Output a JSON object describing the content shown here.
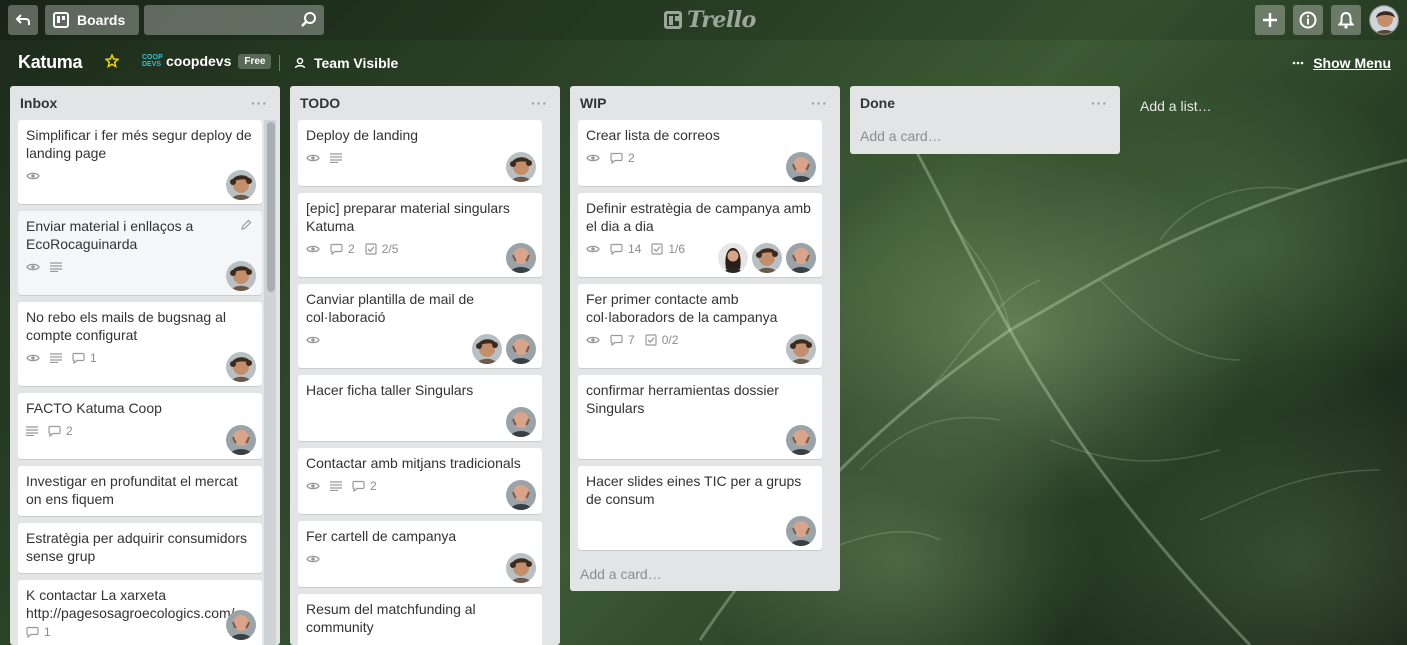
{
  "header": {
    "boards_label": "Boards",
    "search_value": "",
    "logo_text": "Trello"
  },
  "board": {
    "name": "Katuma",
    "team_logo_line1": "COOP",
    "team_logo_line2": "DEVS",
    "team_name": "coopdevs",
    "team_plan": "Free",
    "visibility": "Team Visible",
    "show_menu_label": "Show Menu"
  },
  "lists": [
    {
      "title": "Inbox",
      "cards": [
        {
          "title": "Simplificar i fer més segur deploy de landing page",
          "badges": [
            {
              "icon": "eye-icon",
              "text": ""
            }
          ],
          "members": [
            "curly"
          ]
        },
        {
          "title": "Enviar material i enllaços a EcoRocaguinarda",
          "badges": [
            {
              "icon": "eye-icon",
              "text": ""
            },
            {
              "icon": "description-icon",
              "text": ""
            }
          ],
          "members": [
            "curly"
          ]
        },
        {
          "title": "No rebo els mails de bugsnag al compte configurat",
          "badges": [
            {
              "icon": "eye-icon",
              "text": ""
            },
            {
              "icon": "description-icon",
              "text": ""
            },
            {
              "icon": "comment-icon",
              "text": "1"
            }
          ],
          "members": [
            "curly"
          ]
        },
        {
          "title": "FACTO Katuma Coop",
          "badges": [
            {
              "icon": "description-icon",
              "text": ""
            },
            {
              "icon": "comment-icon",
              "text": "2"
            }
          ],
          "members": [
            "bald"
          ]
        },
        {
          "title": "Investigar en profunditat el mercat on ens fiquem",
          "badges": [],
          "members": []
        },
        {
          "title": "Estratègia per adquirir consumidors sense grup",
          "badges": [],
          "members": []
        },
        {
          "title": "K contactar La xarxeta http://pagesosagroecologics.com/",
          "badges": [
            {
              "icon": "comment-icon",
              "text": "1"
            }
          ],
          "members": [
            "bald"
          ]
        }
      ]
    },
    {
      "title": "TODO",
      "cards": [
        {
          "title": "Deploy de landing",
          "badges": [
            {
              "icon": "eye-icon",
              "text": ""
            },
            {
              "icon": "description-icon",
              "text": ""
            }
          ],
          "members": [
            "curly"
          ]
        },
        {
          "title": "[epic] preparar material singulars Katuma",
          "badges": [
            {
              "icon": "eye-icon",
              "text": ""
            },
            {
              "icon": "comment-icon",
              "text": "2"
            },
            {
              "icon": "checklist-icon",
              "text": "2/5"
            }
          ],
          "members": [
            "bald"
          ]
        },
        {
          "title": "Canviar plantilla de mail de col·laboració",
          "badges": [
            {
              "icon": "eye-icon",
              "text": ""
            }
          ],
          "members": [
            "curly",
            "bald"
          ]
        },
        {
          "title": "Hacer ficha taller Singulars",
          "badges": [],
          "members": [
            "bald"
          ]
        },
        {
          "title": "Contactar amb mitjans tradicionals",
          "badges": [
            {
              "icon": "eye-icon",
              "text": ""
            },
            {
              "icon": "description-icon",
              "text": ""
            },
            {
              "icon": "comment-icon",
              "text": "2"
            }
          ],
          "members": [
            "bald"
          ]
        },
        {
          "title": "Fer cartell de campanya",
          "badges": [
            {
              "icon": "eye-icon",
              "text": ""
            }
          ],
          "members": [
            "curly"
          ]
        },
        {
          "title": "Resum del matchfunding al community",
          "badges": [],
          "members": []
        }
      ]
    },
    {
      "title": "WIP",
      "cards": [
        {
          "title": "Crear lista de correos",
          "badges": [
            {
              "icon": "eye-icon",
              "text": ""
            },
            {
              "icon": "comment-icon",
              "text": "2"
            }
          ],
          "members": [
            "bald"
          ]
        },
        {
          "title": "Definir estratègia de campanya amb el dia a dia",
          "badges": [
            {
              "icon": "eye-icon",
              "text": ""
            },
            {
              "icon": "comment-icon",
              "text": "14"
            },
            {
              "icon": "checklist-icon",
              "text": "1/6"
            }
          ],
          "members": [
            "woman",
            "curly",
            "bald"
          ]
        },
        {
          "title": "Fer primer contacte amb col·laboradors de la campanya",
          "badges": [
            {
              "icon": "eye-icon",
              "text": ""
            },
            {
              "icon": "comment-icon",
              "text": "7"
            },
            {
              "icon": "checklist-icon",
              "text": "0/2"
            }
          ],
          "members": [
            "curly"
          ]
        },
        {
          "title": "confirmar herramientas dossier Singulars",
          "badges": [],
          "members": [
            "bald"
          ]
        },
        {
          "title": "Hacer slides eines TIC per a grups de consum",
          "badges": [],
          "members": [
            "bald"
          ]
        }
      ],
      "add_card": "Add a card…"
    },
    {
      "title": "Done",
      "cards": [],
      "add_card": "Add a card…"
    }
  ],
  "add_list_label": "Add a list…",
  "colors": {
    "accent_star": "#f2d600",
    "team_logo": "#29c5d4",
    "list_bg": "#e2e4e6"
  }
}
